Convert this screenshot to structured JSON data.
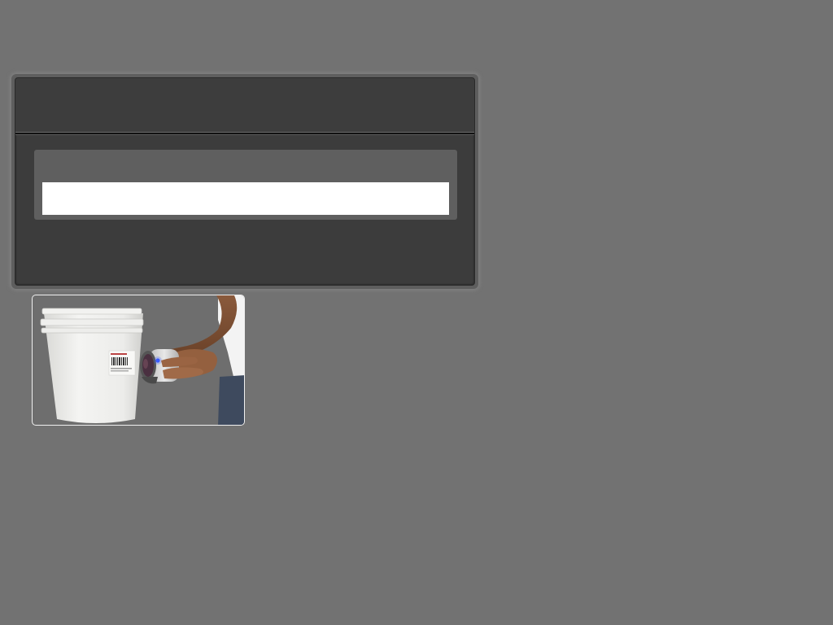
{
  "dialog": {
    "title": "",
    "input_label": "",
    "input_value": "",
    "input_placeholder": ""
  },
  "photo": {
    "subject": "handheld-scanner-on-bucket-image",
    "bucket_color": "#f2f2f0",
    "scanner_led_color": "#3a5bff"
  },
  "colors": {
    "background": "#727272",
    "panel": "#3c3c3c",
    "input_group": "#5f5f5f"
  }
}
